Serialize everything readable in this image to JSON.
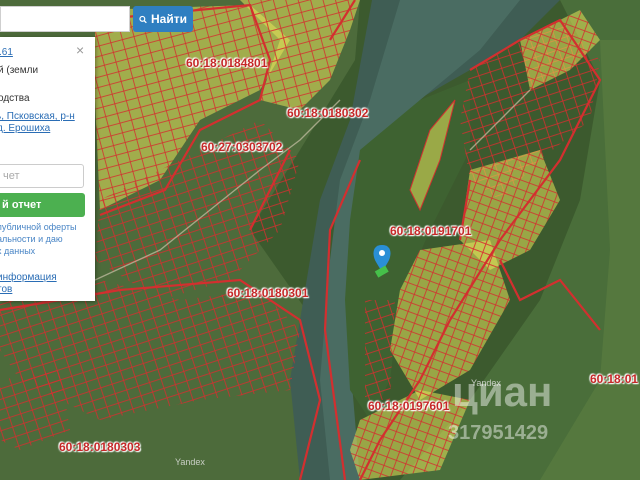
{
  "search": {
    "button_label": "Найти",
    "icon": "search-icon"
  },
  "panel": {
    "line1": ".61",
    "line2": "й (земли",
    "line3": "одства",
    "address1": "ь, Псковская, р-н",
    "address2": "д. Ерошиха",
    "email_placeholder": "чет",
    "report_button": "й отчет",
    "offer1": "публичной оферты",
    "offer2": "альности и даю",
    "offer3": "х данных",
    "info1": "информация",
    "info2": "тов"
  },
  "map": {
    "parcel_labels": [
      {
        "id": "60:18:0184801"
      },
      {
        "id": "60:18:0180302"
      },
      {
        "id": "60:27:0303702"
      },
      {
        "id": "60:18:0191701"
      },
      {
        "id": "60:18:0180301"
      },
      {
        "id": "60:18:0197601"
      },
      {
        "id": "60:18:0180303"
      },
      {
        "id": "60:18:01"
      }
    ],
    "attribution": "Yandex",
    "watermark": "циан",
    "watermark_phone": "317951429",
    "colors": {
      "parcel_border": "#d32f2f",
      "parcel_highlight": "#e6e35a",
      "marker": "#2a8fd6"
    }
  }
}
